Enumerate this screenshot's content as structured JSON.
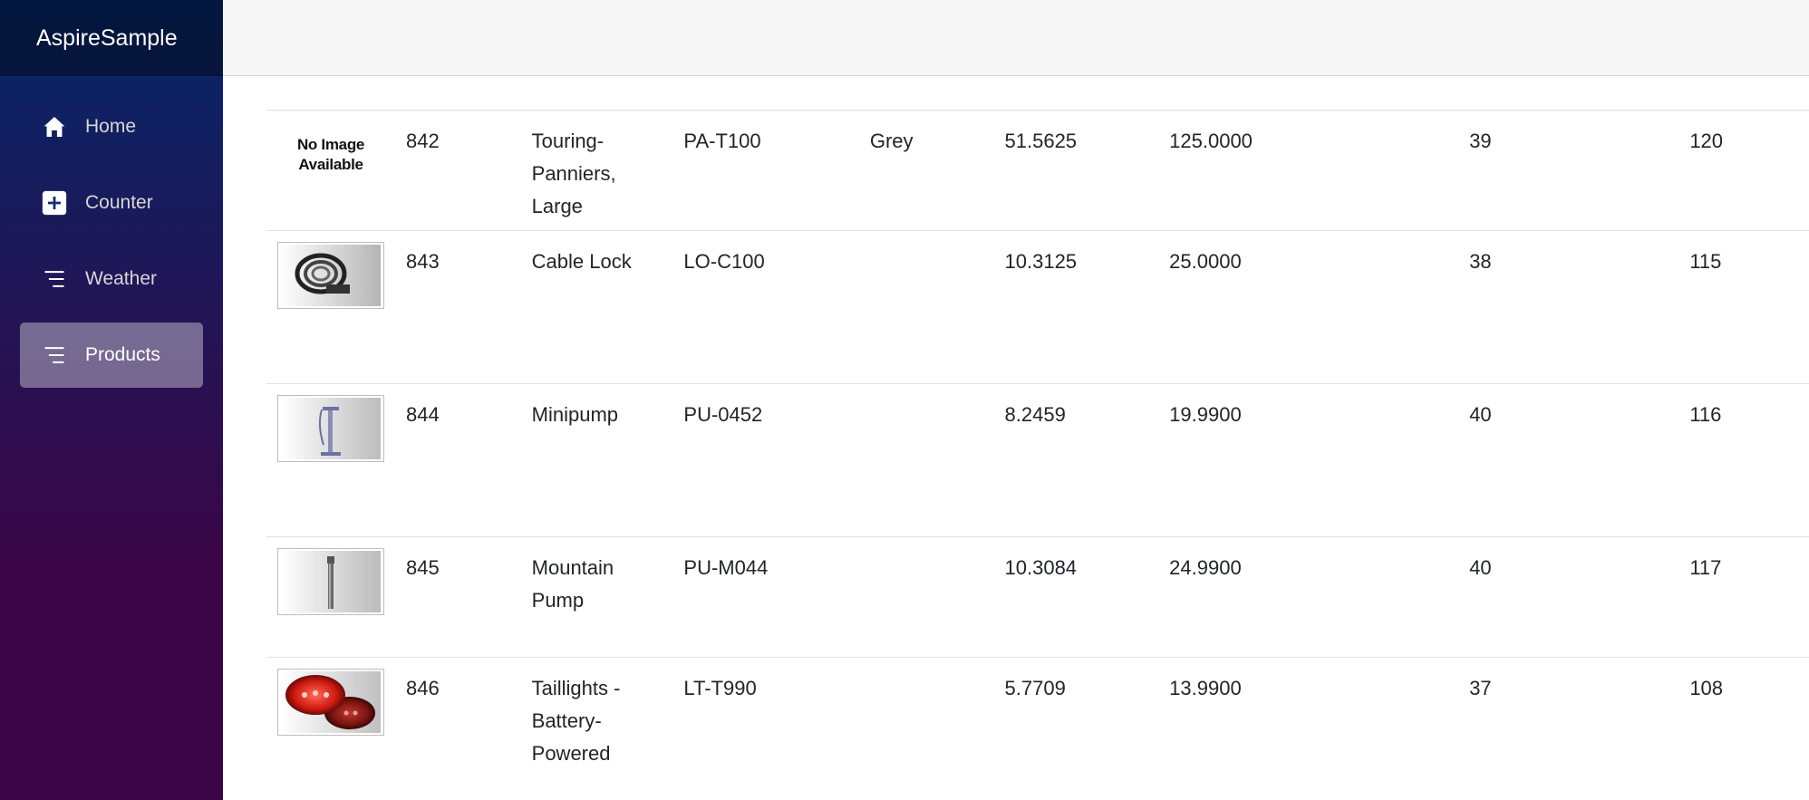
{
  "app": {
    "brand": "AspireSample"
  },
  "sidebar": {
    "items": [
      {
        "label": "Home",
        "icon": "home-icon"
      },
      {
        "label": "Counter",
        "icon": "plus-square-icon"
      },
      {
        "label": "Weather",
        "icon": "list-icon"
      },
      {
        "label": "Products",
        "icon": "list-icon",
        "active": true
      }
    ]
  },
  "colors": {
    "sidebar_gradient_top": "#052767",
    "sidebar_gradient_bottom": "#3a0647",
    "active_item_bg": "rgba(255,255,255,0.37)",
    "topbar_bg": "#f7f7f7"
  },
  "products": {
    "no_image_line1": "No Image",
    "no_image_line2": "Available",
    "rows": [
      {
        "image": "no-image-thumbnail",
        "id": "842",
        "name": "Touring-Panniers, Large",
        "number": "PA-T100",
        "color": "Grey",
        "cost": "51.5625",
        "price": "125.0000",
        "col8": "39",
        "col9": "120"
      },
      {
        "image": "cable-lock-thumbnail",
        "id": "843",
        "name": "Cable Lock",
        "number": "LO-C100",
        "color": "",
        "cost": "10.3125",
        "price": "25.0000",
        "col8": "38",
        "col9": "115"
      },
      {
        "image": "minipump-thumbnail",
        "id": "844",
        "name": "Minipump",
        "number": "PU-0452",
        "color": "",
        "cost": "8.2459",
        "price": "19.9900",
        "col8": "40",
        "col9": "116"
      },
      {
        "image": "mountain-pump-thumbnail",
        "id": "845",
        "name": "Mountain Pump",
        "number": "PU-M044",
        "color": "",
        "cost": "10.3084",
        "price": "24.9900",
        "col8": "40",
        "col9": "117"
      },
      {
        "image": "taillights-thumbnail",
        "id": "846",
        "name": "Taillights - Battery-Powered",
        "number": "LT-T990",
        "color": "",
        "cost": "5.7709",
        "price": "13.9900",
        "col8": "37",
        "col9": "108"
      }
    ]
  }
}
